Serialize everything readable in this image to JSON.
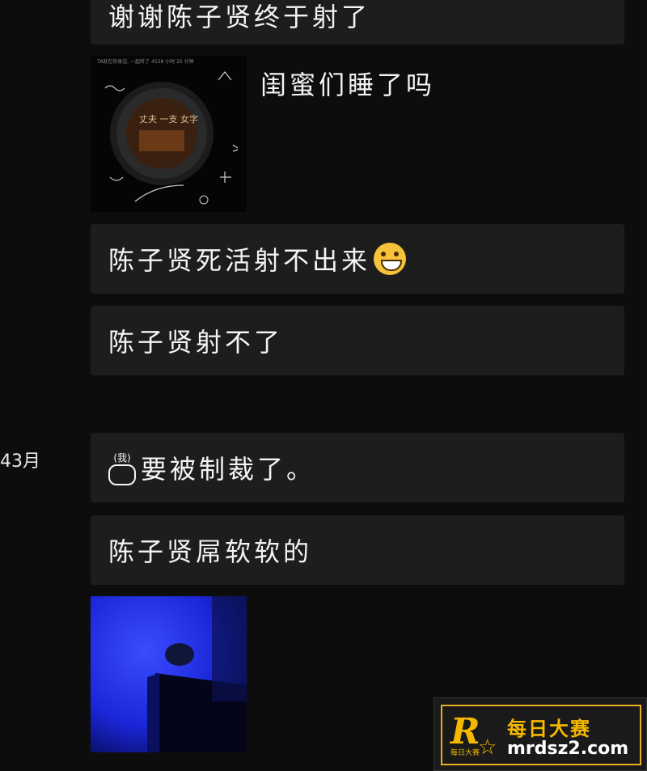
{
  "messages": {
    "m1": "谢谢陈子贤终于射了",
    "caption": "闺蜜们睡了吗",
    "m2": "陈子贤死活射不出来",
    "m3": "陈子贤射不了",
    "date": "43月",
    "me_tag": "(我)",
    "m4": "要被制裁了。",
    "m5": "陈子贤屌软软的"
  },
  "shared_card": {
    "top_text": "TA就在你身边, 一起听了 4538 小时 25 分钟",
    "art_text": "丈夫 一支 女字"
  },
  "watermark": {
    "logo_letter": "R",
    "logo_sub": "每日大赛",
    "name": "每日大赛",
    "url": "mrdsz2.com"
  },
  "colors": {
    "background": "#0d0d0d",
    "bubble": "#1d1d1d",
    "text": "#f4f4f4",
    "accent": "#f5b800",
    "photo_blue": "#1a2cff"
  }
}
